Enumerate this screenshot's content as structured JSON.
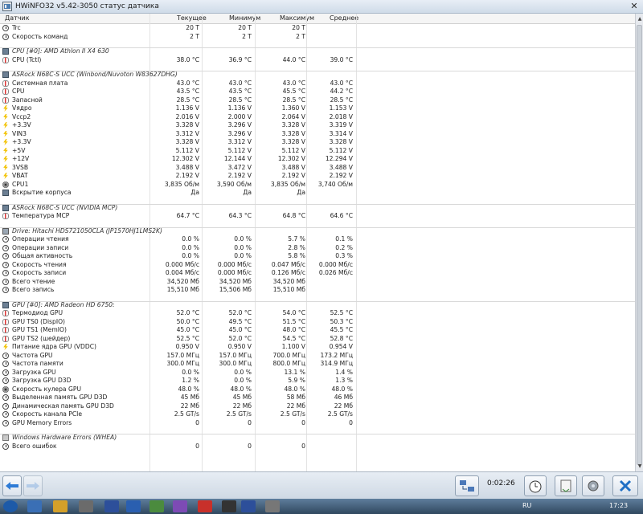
{
  "window": {
    "title": "HWiNFO32 v5.42-3050 статус датчика",
    "close": "✕"
  },
  "columns": {
    "name": "Датчик",
    "current": "Текущее",
    "min": "Минимум",
    "max": "Максимум",
    "avg": "Среднее"
  },
  "rows": [
    {
      "type": "item",
      "icon": "clock-icon",
      "label": "Trc",
      "v": [
        "20 T",
        "20 T",
        "20 T",
        ""
      ]
    },
    {
      "type": "item",
      "icon": "clock-icon",
      "label": "Скорость команд",
      "v": [
        "2 T",
        "2 T",
        "2 T",
        ""
      ]
    },
    {
      "type": "spacer"
    },
    {
      "type": "group",
      "icon": "chip-icon",
      "label": "CPU [#0]: AMD Athlon II X4 630"
    },
    {
      "type": "item",
      "icon": "thermometer-icon",
      "label": "CPU (Tctl)",
      "v": [
        "38.0 °C",
        "36.9 °C",
        "44.0 °C",
        "39.0 °C"
      ]
    },
    {
      "type": "spacer"
    },
    {
      "type": "group",
      "icon": "chip-icon",
      "label": "ASRock N68C-S UCC (Winbond/Nuvoton W83627DHG)"
    },
    {
      "type": "item",
      "icon": "thermometer-icon",
      "label": "Системная плата",
      "v": [
        "43.0 °C",
        "43.0 °C",
        "43.0 °C",
        "43.0 °C"
      ]
    },
    {
      "type": "item",
      "icon": "thermometer-icon",
      "label": "CPU",
      "v": [
        "43.5 °C",
        "43.5 °C",
        "45.5 °C",
        "44.2 °C"
      ]
    },
    {
      "type": "item",
      "icon": "thermometer-icon",
      "label": "Запасной",
      "v": [
        "28.5 °C",
        "28.5 °C",
        "28.5 °C",
        "28.5 °C"
      ]
    },
    {
      "type": "item",
      "icon": "voltage-icon",
      "label": "Vядро",
      "v": [
        "1.136 V",
        "1.136 V",
        "1.360 V",
        "1.153 V"
      ]
    },
    {
      "type": "item",
      "icon": "voltage-icon",
      "label": "Vccp2",
      "v": [
        "2.016 V",
        "2.000 V",
        "2.064 V",
        "2.018 V"
      ]
    },
    {
      "type": "item",
      "icon": "voltage-icon",
      "label": "+3.3V",
      "v": [
        "3.328 V",
        "3.296 V",
        "3.328 V",
        "3.319 V"
      ]
    },
    {
      "type": "item",
      "icon": "voltage-icon",
      "label": "VIN3",
      "v": [
        "3.312 V",
        "3.296 V",
        "3.328 V",
        "3.314 V"
      ]
    },
    {
      "type": "item",
      "icon": "voltage-icon",
      "label": "+3.3V",
      "v": [
        "3.328 V",
        "3.312 V",
        "3.328 V",
        "3.328 V"
      ]
    },
    {
      "type": "item",
      "icon": "voltage-icon",
      "label": "+5V",
      "v": [
        "5.112 V",
        "5.112 V",
        "5.112 V",
        "5.112 V"
      ]
    },
    {
      "type": "item",
      "icon": "voltage-icon",
      "label": "+12V",
      "v": [
        "12.302 V",
        "12.144 V",
        "12.302 V",
        "12.294 V"
      ]
    },
    {
      "type": "item",
      "icon": "voltage-icon",
      "label": "3VSB",
      "v": [
        "3.488 V",
        "3.472 V",
        "3.488 V",
        "3.488 V"
      ]
    },
    {
      "type": "item",
      "icon": "voltage-icon",
      "label": "VBAT",
      "v": [
        "2.192 V",
        "2.192 V",
        "2.192 V",
        "2.192 V"
      ]
    },
    {
      "type": "item",
      "icon": "fan-icon",
      "label": "CPU1",
      "v": [
        "3,835 Об/м",
        "3,590 Об/м",
        "3,835 Об/м",
        "3,740 Об/м"
      ]
    },
    {
      "type": "item",
      "icon": "chip-icon",
      "label": "Вскрытие корпуса",
      "v": [
        "Да",
        "Да",
        "Да",
        ""
      ]
    },
    {
      "type": "spacer"
    },
    {
      "type": "group",
      "icon": "chip-icon",
      "label": "ASRock N68C-S UCC (NVIDIA MCP)"
    },
    {
      "type": "item",
      "icon": "thermometer-icon",
      "label": "Температура MCP",
      "v": [
        "64.7 °C",
        "64.3 °C",
        "64.8 °C",
        "64.6 °C"
      ]
    },
    {
      "type": "spacer"
    },
    {
      "type": "group",
      "icon": "disk-icon",
      "label": "Drive: Hitachi HDS721050CLA (JP1570HJ1LMS2K)"
    },
    {
      "type": "item",
      "icon": "clock-icon",
      "label": "Операции чтения",
      "v": [
        "0.0 %",
        "0.0 %",
        "5.7 %",
        "0.1 %"
      ]
    },
    {
      "type": "item",
      "icon": "clock-icon",
      "label": "Операции записи",
      "v": [
        "0.0 %",
        "0.0 %",
        "2.8 %",
        "0.2 %"
      ]
    },
    {
      "type": "item",
      "icon": "clock-icon",
      "label": "Общая активность",
      "v": [
        "0.0 %",
        "0.0 %",
        "5.8 %",
        "0.3 %"
      ]
    },
    {
      "type": "item",
      "icon": "clock-icon",
      "label": "Скорость чтения",
      "v": [
        "0.000 Мб/с",
        "0.000 Мб/с",
        "0.047 Мб/с",
        "0.000 Мб/с"
      ]
    },
    {
      "type": "item",
      "icon": "clock-icon",
      "label": "Скорость записи",
      "v": [
        "0.004 Мб/с",
        "0.000 Мб/с",
        "0.126 Мб/с",
        "0.026 Мб/с"
      ]
    },
    {
      "type": "item",
      "icon": "clock-icon",
      "label": "Всего чтение",
      "v": [
        "34,520 Мб",
        "34,520 Мб",
        "34,520 Мб",
        ""
      ]
    },
    {
      "type": "item",
      "icon": "clock-icon",
      "label": "Всего запись",
      "v": [
        "15,510 Мб",
        "15,506 Мб",
        "15,510 Мб",
        ""
      ]
    },
    {
      "type": "spacer"
    },
    {
      "type": "group",
      "icon": "chip-icon",
      "label": "GPU [#0]: AMD Radeon HD 6750:"
    },
    {
      "type": "item",
      "icon": "thermometer-icon",
      "label": "Термодиод GPU",
      "v": [
        "52.0 °C",
        "52.0 °C",
        "54.0 °C",
        "52.5 °C"
      ]
    },
    {
      "type": "item",
      "icon": "thermometer-icon",
      "label": "GPU TS0 (DispIO)",
      "v": [
        "50.0 °C",
        "49.5 °C",
        "51.5 °C",
        "50.3 °C"
      ]
    },
    {
      "type": "item",
      "icon": "thermometer-icon",
      "label": "GPU TS1 (MemIO)",
      "v": [
        "45.0 °C",
        "45.0 °C",
        "48.0 °C",
        "45.5 °C"
      ]
    },
    {
      "type": "item",
      "icon": "thermometer-icon",
      "label": "GPU TS2 (шейдер)",
      "v": [
        "52.5 °C",
        "52.0 °C",
        "54.5 °C",
        "52.8 °C"
      ]
    },
    {
      "type": "item",
      "icon": "voltage-icon",
      "label": "Питание ядра GPU (VDDC)",
      "v": [
        "0.950 V",
        "0.950 V",
        "1.100 V",
        "0.954 V"
      ]
    },
    {
      "type": "item",
      "icon": "clock-icon",
      "label": "Частота GPU",
      "v": [
        "157.0 МГц",
        "157.0 МГц",
        "700.0 МГц",
        "173.2 МГц"
      ]
    },
    {
      "type": "item",
      "icon": "clock-icon",
      "label": "Частота памяти",
      "v": [
        "300.0 МГц",
        "300.0 МГц",
        "800.0 МГц",
        "314.9 МГц"
      ]
    },
    {
      "type": "item",
      "icon": "clock-icon",
      "label": "Загрузка GPU",
      "v": [
        "0.0 %",
        "0.0 %",
        "13.1 %",
        "1.4 %"
      ]
    },
    {
      "type": "item",
      "icon": "clock-icon",
      "label": "Загрузка GPU D3D",
      "v": [
        "1.2 %",
        "0.0 %",
        "5.9 %",
        "1.3 %"
      ]
    },
    {
      "type": "item",
      "icon": "fan-icon",
      "label": "Скорость кулера GPU",
      "v": [
        "48.0 %",
        "48.0 %",
        "48.0 %",
        "48.0 %"
      ]
    },
    {
      "type": "item",
      "icon": "clock-icon",
      "label": "Выделенная память GPU D3D",
      "v": [
        "45 Мб",
        "45 Мб",
        "58 Мб",
        "46 Мб"
      ]
    },
    {
      "type": "item",
      "icon": "clock-icon",
      "label": "Динамическая память GPU D3D",
      "v": [
        "22 Мб",
        "22 Мб",
        "22 Мб",
        "22 Мб"
      ]
    },
    {
      "type": "item",
      "icon": "clock-icon",
      "label": "Скорость канала PCIe",
      "v": [
        "2.5 GT/s",
        "2.5 GT/s",
        "2.5 GT/s",
        "2.5 GT/s"
      ]
    },
    {
      "type": "item",
      "icon": "clock-icon",
      "label": "GPU Memory Errors",
      "v": [
        "0",
        "0",
        "0",
        "0"
      ]
    },
    {
      "type": "spacer"
    },
    {
      "type": "group",
      "icon": "warning-icon",
      "label": "Windows Hardware Errors (WHEA)"
    },
    {
      "type": "item",
      "icon": "clock-icon",
      "label": "Всего ошибок",
      "v": [
        "0",
        "0",
        "0",
        ""
      ]
    }
  ],
  "toolbar": {
    "elapsed": "0:02:26"
  },
  "taskbar": {
    "lang": "RU",
    "time": "17:23"
  },
  "colors": {
    "window_bg": "#dde6ef",
    "taskbar": "#30485f",
    "accent": "#1f6fc5"
  }
}
